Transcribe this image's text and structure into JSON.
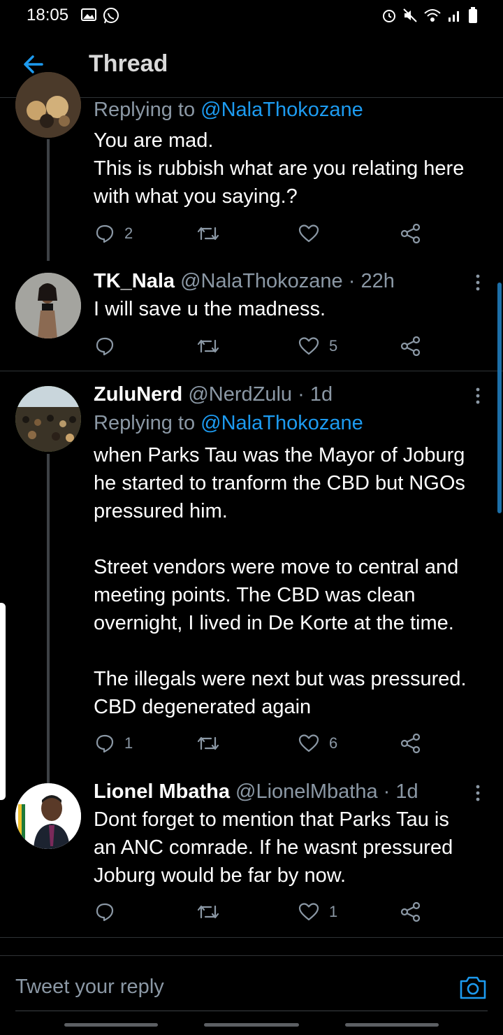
{
  "status_bar": {
    "time": "18:05"
  },
  "header": {
    "title": "Thread"
  },
  "colors": {
    "accent": "#1d9bf0",
    "muted": "#8b98a5",
    "background": "#000000"
  },
  "tweets": [
    {
      "replying_prefix": "Replying to",
      "replying_to": "@NalaThokozane",
      "body": [
        "You are mad.",
        "This is rubbish what are you relating here",
        "with what you saying.?"
      ],
      "reply_count": "2",
      "retweet_count": "",
      "like_count": ""
    },
    {
      "name": "TK_Nala",
      "handle": "@NalaThokozane",
      "time": " · 22h",
      "body": [
        "I will save u the madness."
      ],
      "reply_count": "",
      "retweet_count": "",
      "like_count": "5"
    },
    {
      "name": "ZuluNerd",
      "handle": "@NerdZulu",
      "time": " · 1d",
      "replying_prefix": "Replying to",
      "replying_to": "@NalaThokozane",
      "body": [
        "when Parks Tau was the Mayor of Joburg",
        "he started to tranform the CBD but NGOs",
        "pressured him.",
        "",
        "Street vendors were move to central and",
        "meeting points. The CBD was clean",
        "overnight, I lived in De Korte at the time.",
        "",
        "The illegals were next but was pressured.",
        "CBD degenerated again"
      ],
      "reply_count": "1",
      "retweet_count": "",
      "like_count": "6"
    },
    {
      "name": "Lionel Mbatha",
      "handle": "@LionelMbatha",
      "time": " · 1d",
      "body": [
        "Dont forget to mention that Parks Tau is",
        "an ANC comrade. If he wasnt pressured",
        "Joburg would be far by now."
      ],
      "reply_count": "",
      "retweet_count": "",
      "like_count": "1"
    }
  ],
  "compose": {
    "placeholder": "Tweet your reply"
  }
}
